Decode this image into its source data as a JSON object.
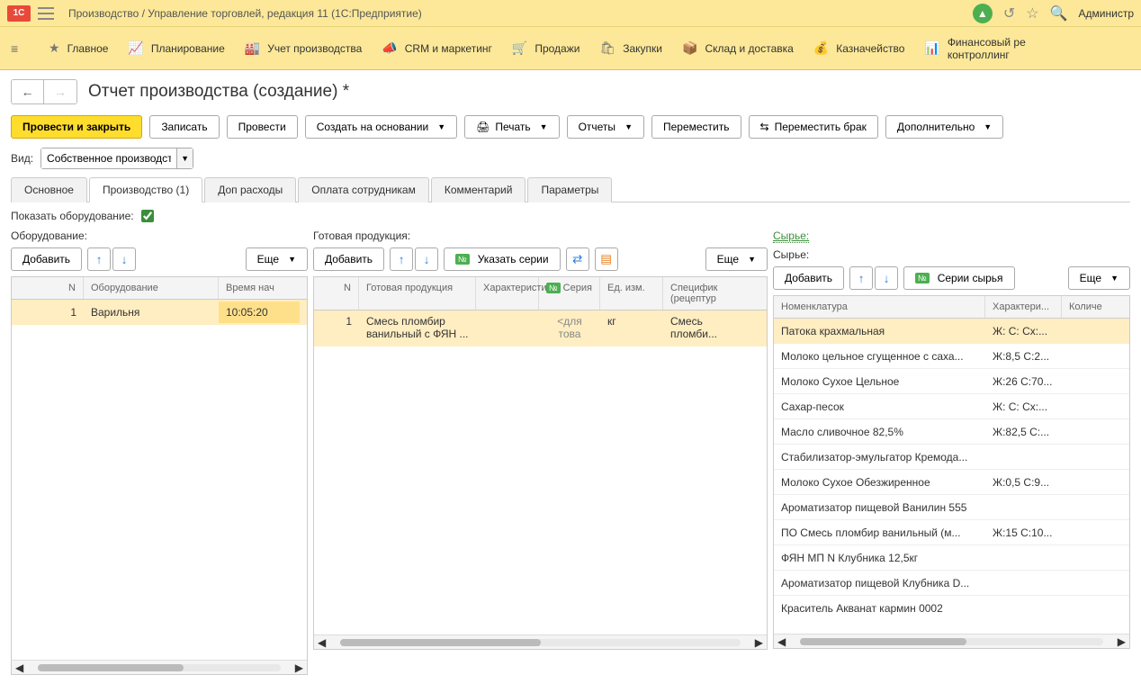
{
  "title": "Производство / Управление торговлей, редакция 11  (1С:Предприятие)",
  "titlebar_user": "Администр",
  "nav": {
    "main": "Главное",
    "plan": "Планирование",
    "prod": "Учет производства",
    "crm": "CRM и маркетинг",
    "sales": "Продажи",
    "purchase": "Закупки",
    "warehouse": "Склад и доставка",
    "treasury": "Казначейство",
    "fin": "Финансовый ре",
    "fin2": "контроллинг"
  },
  "page_title": "Отчет производства (создание) *",
  "toolbar": {
    "post_close": "Провести и закрыть",
    "write": "Записать",
    "post": "Провести",
    "create_from": "Создать на основании",
    "print": "Печать",
    "reports": "Отчеты",
    "move": "Переместить",
    "move_defect": "Переместить брак",
    "more": "Дополнительно"
  },
  "vid_label": "Вид:",
  "vid_value": "Собственное производств",
  "tabs": {
    "basic": "Основное",
    "prod": "Производство (1)",
    "exp": "Доп расходы",
    "pay": "Оплата сотрудникам",
    "comment": "Комментарий",
    "params": "Параметры"
  },
  "show_eq_label": "Показать оборудование:",
  "equipment": {
    "label": "Оборудование:",
    "add": "Добавить",
    "more": "Еще",
    "columns": {
      "n": "N",
      "eq": "Оборудование",
      "start": "Время нач"
    },
    "rows": [
      {
        "n": "1",
        "eq": "Варильня",
        "start": "10:05:20"
      }
    ]
  },
  "product": {
    "label": "Готовая продукция:",
    "add": "Добавить",
    "series": "Указать серии",
    "more": "Еще",
    "columns": {
      "n": "N",
      "prod": "Готовая продукция",
      "char": "Характеристика",
      "serial": "Серия",
      "unit": "Ед. изм.",
      "spec": "Специфик (рецептур"
    },
    "rows": [
      {
        "n": "1",
        "prod": "Смесь пломбир ванильный с ФЯН ...",
        "char": "",
        "serial": "<для това",
        "unit": "кг",
        "spec": "Смесь пломби..."
      }
    ]
  },
  "raw": {
    "label_link": "Сырье:",
    "label2": "Сырье:",
    "add": "Добавить",
    "series": "Серии сырья",
    "more": "Еще",
    "columns": {
      "nom": "Номенклатура",
      "char": "Характери...",
      "qty": "Количе"
    },
    "rows": [
      {
        "nom": "Патока крахмальная",
        "char": "Ж: С: Сх:...",
        "sel": true
      },
      {
        "nom": "Молоко цельное сгущенное с саха...",
        "char": "Ж:8,5 С:2..."
      },
      {
        "nom": "Молоко Сухое Цельное",
        "char": "Ж:26 С:70..."
      },
      {
        "nom": "Сахар-песок",
        "char": "Ж: С: Сх:..."
      },
      {
        "nom": "Масло сливочное 82,5%",
        "char": "Ж:82,5 С:..."
      },
      {
        "nom": "Стабилизатор-эмульгатор Кремода...",
        "char": ""
      },
      {
        "nom": "Молоко Сухое Обезжиренное",
        "char": "Ж:0,5 С:9..."
      },
      {
        "nom": "Ароматизатор пищевой Ванилин 555",
        "char": ""
      },
      {
        "nom": "ПО Смесь пломбир ванильный (м...",
        "char": "Ж:15 С:10..."
      },
      {
        "nom": "ФЯН МП N Клубника 12,5кг",
        "char": ""
      },
      {
        "nom": "Ароматизатор пищевой Клубника D...",
        "char": ""
      },
      {
        "nom": "Краситель Акванат кармин 0002",
        "char": ""
      }
    ]
  },
  "num_badge": "№"
}
